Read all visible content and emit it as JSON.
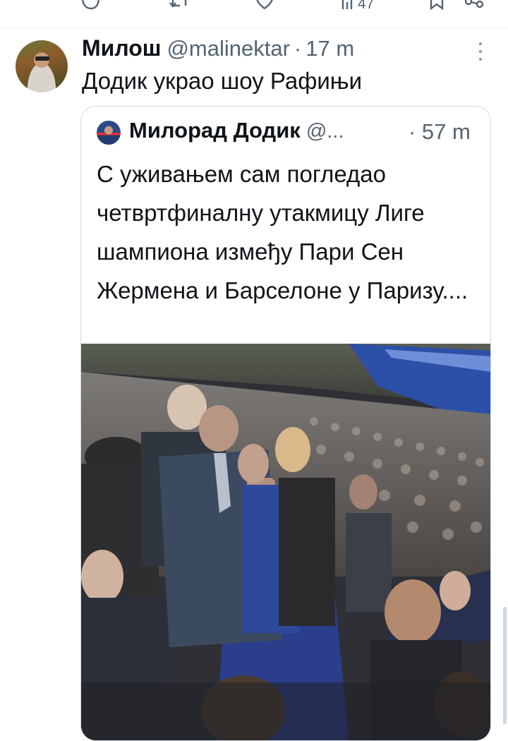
{
  "actions": {
    "views_count": "47"
  },
  "tweet": {
    "author_name": "Милош",
    "handle": "@malinektar",
    "separator": "·",
    "time": "17 m",
    "text": "Додик украо шоу Рафињи"
  },
  "quoted": {
    "author_name": "Милорад Додик",
    "handle": "@...",
    "time": "· 57 m",
    "text": "С уживањем сам погледао четвртфиналну утакмицу Лиге шампиона између Пари Сен Жермена и Барселоне у Паризу...."
  },
  "icons": [
    "reply-icon",
    "retweet-icon",
    "like-icon",
    "views-icon",
    "bookmark-icon",
    "share-icon",
    "more-options-icon"
  ]
}
